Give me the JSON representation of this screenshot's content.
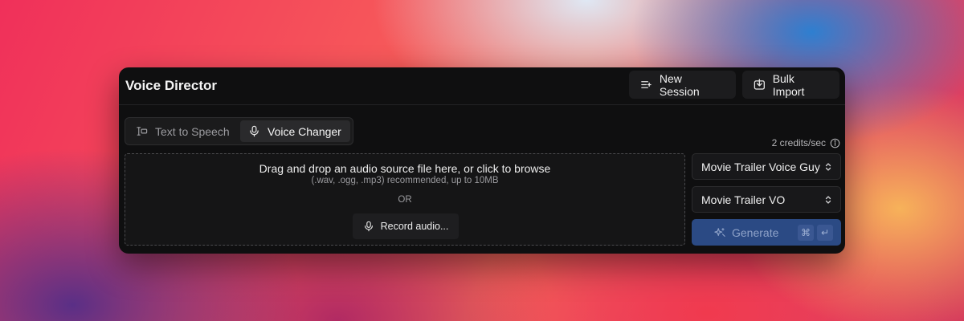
{
  "header": {
    "title": "Voice Director",
    "new_session_label": "New Session",
    "bulk_import_label": "Bulk Import"
  },
  "tabs": [
    {
      "label": "Text to Speech",
      "icon": "text-to-speech-icon",
      "active": false
    },
    {
      "label": "Voice Changer",
      "icon": "microphone-icon",
      "active": true
    }
  ],
  "credits": {
    "text": "2 credits/sec",
    "icon": "info-icon"
  },
  "dropzone": {
    "title": "Drag and drop an audio source file here, or click to browse",
    "subtitle": "(.wav, .ogg, .mp3) recommended, up to 10MB",
    "or_text": "OR",
    "record_label": "Record audio..."
  },
  "voice_select": {
    "value": "Movie Trailer Voice Guy"
  },
  "model_select": {
    "value": "Movie Trailer VO"
  },
  "generate": {
    "label": "Generate",
    "shortcut_keys": [
      "⌘",
      "↵"
    ]
  },
  "colors": {
    "window_bg": "#0f0f10",
    "generate_bg": "#2b4a84",
    "active_tab_bg": "#2a2a2c"
  }
}
